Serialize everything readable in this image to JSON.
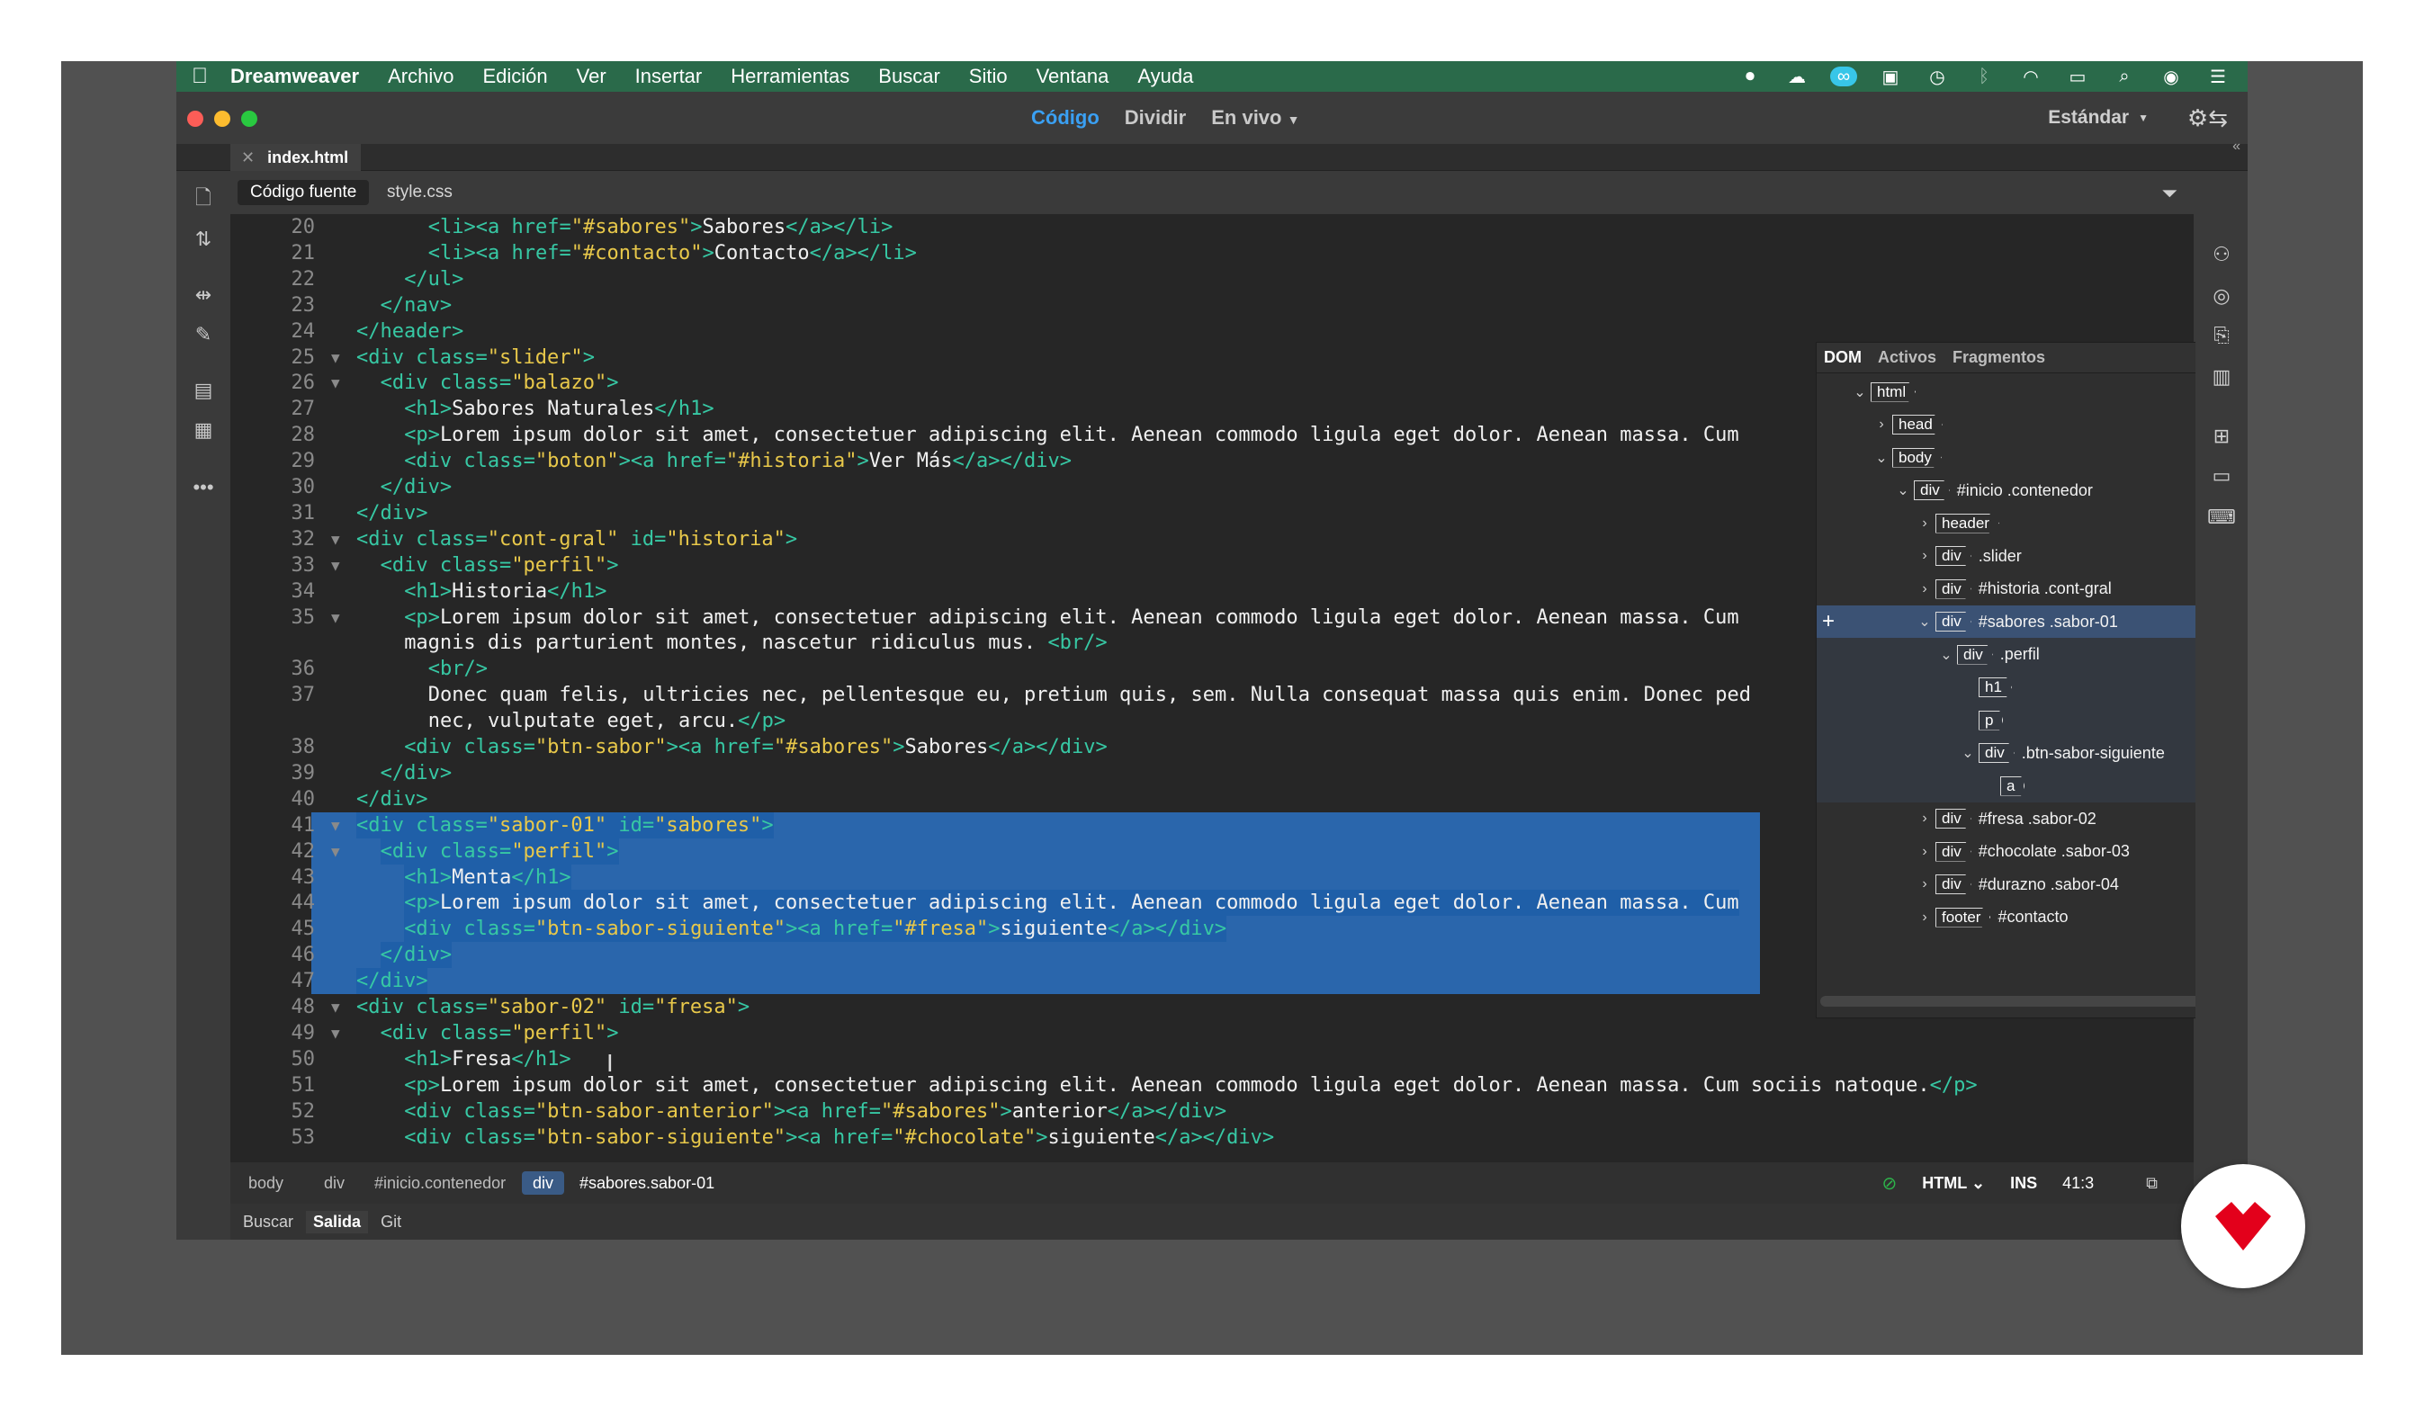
{
  "menubar": {
    "app": "Dreamweaver",
    "items": [
      "Archivo",
      "Edición",
      "Ver",
      "Insertar",
      "Herramientas",
      "Buscar",
      "Sitio",
      "Ventana",
      "Ayuda"
    ],
    "tray_icons": [
      "record-icon",
      "cloud-icon",
      "creative-cloud-icon",
      "chat-icon",
      "time-machine-icon",
      "bluetooth-icon",
      "wifi-icon",
      "battery-icon",
      "spotlight-icon",
      "siri-icon",
      "list-icon"
    ]
  },
  "titlebar": {
    "views": [
      "Código",
      "Dividir",
      "En vivo"
    ],
    "active_view": "Código",
    "workspace": "Estándar"
  },
  "document_tab": "index.html",
  "related_files": [
    "Código fuente",
    "style.css"
  ],
  "code_lines": [
    {
      "n": "20",
      "fold": "",
      "sel": false,
      "indent": 6,
      "parts": [
        [
          "tag",
          "<li><a "
        ],
        [
          "attr",
          "href="
        ],
        [
          "str",
          "\"#sabores\""
        ],
        [
          "tag",
          ">"
        ],
        [
          "txt",
          "Sabores"
        ],
        [
          "tag",
          "</a></li>"
        ]
      ]
    },
    {
      "n": "21",
      "fold": "",
      "sel": false,
      "indent": 6,
      "parts": [
        [
          "tag",
          "<li><a "
        ],
        [
          "attr",
          "href="
        ],
        [
          "str",
          "\"#contacto\""
        ],
        [
          "tag",
          ">"
        ],
        [
          "txt",
          "Contacto"
        ],
        [
          "tag",
          "</a></li>"
        ]
      ]
    },
    {
      "n": "22",
      "fold": "",
      "sel": false,
      "indent": 4,
      "parts": [
        [
          "tag",
          "</ul>"
        ]
      ]
    },
    {
      "n": "23",
      "fold": "",
      "sel": false,
      "indent": 2,
      "parts": [
        [
          "tag",
          "</nav>"
        ]
      ]
    },
    {
      "n": "24",
      "fold": "",
      "sel": false,
      "indent": 0,
      "parts": [
        [
          "tag",
          "</header>"
        ]
      ]
    },
    {
      "n": "25",
      "fold": "▼",
      "sel": false,
      "indent": 0,
      "parts": [
        [
          "tag",
          "<div "
        ],
        [
          "attr",
          "class="
        ],
        [
          "str",
          "\"slider\""
        ],
        [
          "tag",
          ">"
        ]
      ]
    },
    {
      "n": "26",
      "fold": "▼",
      "sel": false,
      "indent": 2,
      "parts": [
        [
          "tag",
          "<div "
        ],
        [
          "attr",
          "class="
        ],
        [
          "str",
          "\"balazo\""
        ],
        [
          "tag",
          ">"
        ]
      ]
    },
    {
      "n": "27",
      "fold": "",
      "sel": false,
      "indent": 4,
      "parts": [
        [
          "tag",
          "<h1>"
        ],
        [
          "txt",
          "Sabores Naturales"
        ],
        [
          "tag",
          "</h1>"
        ]
      ]
    },
    {
      "n": "28",
      "fold": "",
      "sel": false,
      "indent": 4,
      "parts": [
        [
          "tag",
          "<p>"
        ],
        [
          "txt",
          "Lorem ipsum dolor sit amet, consectetuer adipiscing elit. Aenean commodo ligula eget dolor. Aenean massa. Cum"
        ]
      ]
    },
    {
      "n": "29",
      "fold": "",
      "sel": false,
      "indent": 4,
      "parts": [
        [
          "tag",
          "<div "
        ],
        [
          "attr",
          "class="
        ],
        [
          "str",
          "\"boton\""
        ],
        [
          "tag",
          "><a "
        ],
        [
          "attr",
          "href="
        ],
        [
          "str",
          "\"#historia\""
        ],
        [
          "tag",
          ">"
        ],
        [
          "txt",
          "Ver Más"
        ],
        [
          "tag",
          "</a></div>"
        ]
      ]
    },
    {
      "n": "30",
      "fold": "",
      "sel": false,
      "indent": 2,
      "parts": [
        [
          "tag",
          "</div>"
        ]
      ]
    },
    {
      "n": "31",
      "fold": "",
      "sel": false,
      "indent": 0,
      "parts": [
        [
          "tag",
          "</div>"
        ]
      ]
    },
    {
      "n": "32",
      "fold": "▼",
      "sel": false,
      "indent": 0,
      "parts": [
        [
          "tag",
          "<div "
        ],
        [
          "attr",
          "class="
        ],
        [
          "str",
          "\"cont-gral\""
        ],
        [
          "txt",
          " "
        ],
        [
          "attr",
          "id="
        ],
        [
          "str",
          "\"historia\""
        ],
        [
          "tag",
          ">"
        ]
      ]
    },
    {
      "n": "33",
      "fold": "▼",
      "sel": false,
      "indent": 2,
      "parts": [
        [
          "tag",
          "<div "
        ],
        [
          "attr",
          "class="
        ],
        [
          "str",
          "\"perfil\""
        ],
        [
          "tag",
          ">"
        ]
      ]
    },
    {
      "n": "34",
      "fold": "",
      "sel": false,
      "indent": 4,
      "parts": [
        [
          "tag",
          "<h1>"
        ],
        [
          "txt",
          "Historia"
        ],
        [
          "tag",
          "</h1>"
        ]
      ]
    },
    {
      "n": "35",
      "fold": "▼",
      "sel": false,
      "indent": 4,
      "parts": [
        [
          "tag",
          "<p>"
        ],
        [
          "txt",
          "Lorem ipsum dolor sit amet, consectetuer adipiscing elit. Aenean commodo ligula eget dolor. Aenean massa. Cum"
        ]
      ]
    },
    {
      "n": "",
      "fold": "",
      "sel": false,
      "indent": 4,
      "parts": [
        [
          "txt",
          "magnis dis parturient montes, nascetur ridiculus mus. "
        ],
        [
          "tag",
          "<br/>"
        ]
      ]
    },
    {
      "n": "36",
      "fold": "",
      "sel": false,
      "indent": 6,
      "parts": [
        [
          "tag",
          "<br/>"
        ]
      ]
    },
    {
      "n": "37",
      "fold": "",
      "sel": false,
      "indent": 6,
      "parts": [
        [
          "txt",
          "Donec quam felis, ultricies nec, pellentesque eu, pretium quis, sem. Nulla consequat massa quis enim. Donec ped"
        ]
      ]
    },
    {
      "n": "",
      "fold": "",
      "sel": false,
      "indent": 6,
      "parts": [
        [
          "txt",
          "nec, vulputate eget, arcu."
        ],
        [
          "tag",
          "</p>"
        ]
      ]
    },
    {
      "n": "38",
      "fold": "",
      "sel": false,
      "indent": 4,
      "parts": [
        [
          "tag",
          "<div "
        ],
        [
          "attr",
          "class="
        ],
        [
          "str",
          "\"btn-sabor\""
        ],
        [
          "tag",
          "><a "
        ],
        [
          "attr",
          "href="
        ],
        [
          "str",
          "\"#sabores\""
        ],
        [
          "tag",
          ">"
        ],
        [
          "txt",
          "Sabores"
        ],
        [
          "tag",
          "</a></div>"
        ]
      ]
    },
    {
      "n": "39",
      "fold": "",
      "sel": false,
      "indent": 2,
      "parts": [
        [
          "tag",
          "</div>"
        ]
      ]
    },
    {
      "n": "40",
      "fold": "",
      "sel": false,
      "indent": 0,
      "parts": [
        [
          "tag",
          "</div>"
        ]
      ]
    },
    {
      "n": "41",
      "fold": "▼",
      "sel": true,
      "indent": 0,
      "parts": [
        [
          "tag",
          "<div "
        ],
        [
          "attr",
          "class="
        ],
        [
          "str",
          "\"sabor-01\""
        ],
        [
          "txt",
          " "
        ],
        [
          "attr",
          "id="
        ],
        [
          "str",
          "\"sabores\""
        ],
        [
          "tag",
          ">"
        ]
      ]
    },
    {
      "n": "42",
      "fold": "▼",
      "sel": true,
      "indent": 2,
      "parts": [
        [
          "tag",
          "<div "
        ],
        [
          "attr",
          "class="
        ],
        [
          "str",
          "\"perfil\""
        ],
        [
          "tag",
          ">"
        ]
      ]
    },
    {
      "n": "43",
      "fold": "",
      "sel": true,
      "indent": 4,
      "parts": [
        [
          "tag",
          "<h1>"
        ],
        [
          "txt",
          "Menta"
        ],
        [
          "tag",
          "</h1>"
        ]
      ]
    },
    {
      "n": "44",
      "fold": "",
      "sel": true,
      "indent": 4,
      "parts": [
        [
          "tag",
          "<p>"
        ],
        [
          "txt",
          "Lorem ipsum dolor sit amet, consectetuer adipiscing elit. Aenean commodo ligula eget dolor. Aenean massa. Cum"
        ]
      ]
    },
    {
      "n": "45",
      "fold": "",
      "sel": true,
      "indent": 4,
      "parts": [
        [
          "tag",
          "<div "
        ],
        [
          "attr",
          "class="
        ],
        [
          "str",
          "\"btn-sabor-siguiente\""
        ],
        [
          "tag",
          "><a "
        ],
        [
          "attr",
          "href="
        ],
        [
          "str",
          "\"#fresa\""
        ],
        [
          "tag",
          ">"
        ],
        [
          "txt",
          "siguiente"
        ],
        [
          "tag",
          "</a></div>"
        ]
      ]
    },
    {
      "n": "46",
      "fold": "",
      "sel": true,
      "indent": 2,
      "parts": [
        [
          "tag",
          "</div>"
        ]
      ]
    },
    {
      "n": "47",
      "fold": "",
      "sel": true,
      "indent": 0,
      "parts": [
        [
          "tag",
          "</div>"
        ]
      ]
    },
    {
      "n": "48",
      "fold": "▼",
      "sel": false,
      "indent": 0,
      "parts": [
        [
          "tag",
          "<div "
        ],
        [
          "attr",
          "class="
        ],
        [
          "str",
          "\"sabor-02\""
        ],
        [
          "txt",
          " "
        ],
        [
          "attr",
          "id="
        ],
        [
          "str",
          "\"fresa\""
        ],
        [
          "tag",
          ">"
        ]
      ]
    },
    {
      "n": "49",
      "fold": "▼",
      "sel": false,
      "indent": 2,
      "parts": [
        [
          "tag",
          "<div "
        ],
        [
          "attr",
          "class="
        ],
        [
          "str",
          "\"perfil\""
        ],
        [
          "tag",
          ">"
        ]
      ]
    },
    {
      "n": "50",
      "fold": "",
      "sel": false,
      "indent": 4,
      "parts": [
        [
          "tag",
          "<h1>"
        ],
        [
          "txt",
          "Fresa"
        ],
        [
          "tag",
          "</h1>"
        ]
      ]
    },
    {
      "n": "51",
      "fold": "",
      "sel": false,
      "indent": 4,
      "parts": [
        [
          "tag",
          "<p>"
        ],
        [
          "txt",
          "Lorem ipsum dolor sit amet, consectetuer adipiscing elit. Aenean commodo ligula eget dolor. Aenean massa. Cum sociis natoque."
        ],
        [
          "tag",
          "</p>"
        ]
      ]
    },
    {
      "n": "52",
      "fold": "",
      "sel": false,
      "indent": 4,
      "parts": [
        [
          "tag",
          "<div "
        ],
        [
          "attr",
          "class="
        ],
        [
          "str",
          "\"btn-sabor-anterior\""
        ],
        [
          "tag",
          "><a "
        ],
        [
          "attr",
          "href="
        ],
        [
          "str",
          "\"#sabores\""
        ],
        [
          "tag",
          ">"
        ],
        [
          "txt",
          "anterior"
        ],
        [
          "tag",
          "</a></div>"
        ]
      ]
    },
    {
      "n": "53",
      "fold": "",
      "sel": false,
      "indent": 4,
      "parts": [
        [
          "tag",
          "<div "
        ],
        [
          "attr",
          "class="
        ],
        [
          "str",
          "\"btn-sabor-siguiente\""
        ],
        [
          "tag",
          "><a "
        ],
        [
          "attr",
          "href="
        ],
        [
          "str",
          "\"#chocolate\""
        ],
        [
          "tag",
          ">"
        ],
        [
          "txt",
          "siguiente"
        ],
        [
          "tag",
          "</a></div>"
        ]
      ]
    }
  ],
  "dom_panel": {
    "tabs": [
      "DOM",
      "Activos",
      "Fragmentos"
    ],
    "active_tab": "DOM",
    "nodes": [
      {
        "depth": 1,
        "chev": "⌄",
        "tag": "html",
        "label": "",
        "state": ""
      },
      {
        "depth": 2,
        "chev": "›",
        "tag": "head",
        "label": "",
        "state": ""
      },
      {
        "depth": 2,
        "chev": "⌄",
        "tag": "body",
        "label": "",
        "state": ""
      },
      {
        "depth": 3,
        "chev": "⌄",
        "tag": "div",
        "label": "#inicio .contenedor",
        "state": ""
      },
      {
        "depth": 4,
        "chev": "›",
        "tag": "header",
        "label": "",
        "state": ""
      },
      {
        "depth": 4,
        "chev": "›",
        "tag": "div",
        "label": ".slider",
        "state": ""
      },
      {
        "depth": 4,
        "chev": "›",
        "tag": "div",
        "label": "#historia .cont-gral",
        "state": ""
      },
      {
        "depth": 4,
        "chev": "⌄",
        "tag": "div",
        "label": "#sabores .sabor-01",
        "state": "selected"
      },
      {
        "depth": 5,
        "chev": "⌄",
        "tag": "div",
        "label": ".perfil",
        "state": "sub"
      },
      {
        "depth": 6,
        "chev": "",
        "tag": "h1",
        "label": "",
        "state": "sub"
      },
      {
        "depth": 6,
        "chev": "",
        "tag": "p",
        "label": "",
        "state": "sub"
      },
      {
        "depth": 6,
        "chev": "⌄",
        "tag": "div",
        "label": ".btn-sabor-siguiente",
        "state": "sub"
      },
      {
        "depth": 7,
        "chev": "",
        "tag": "a",
        "label": "",
        "state": "sub"
      },
      {
        "depth": 4,
        "chev": "›",
        "tag": "div",
        "label": "#fresa .sabor-02",
        "state": ""
      },
      {
        "depth": 4,
        "chev": "›",
        "tag": "div",
        "label": "#chocolate .sabor-03",
        "state": ""
      },
      {
        "depth": 4,
        "chev": "›",
        "tag": "div",
        "label": "#durazno .sabor-04",
        "state": ""
      },
      {
        "depth": 4,
        "chev": "›",
        "tag": "footer",
        "label": "#contacto",
        "state": ""
      }
    ]
  },
  "statusbar": {
    "crumbs": [
      "body",
      "div",
      "#inicio.contenedor",
      "div",
      "#sabores.sabor-01"
    ],
    "active_crumb_index": 3,
    "language": "HTML",
    "mode": "INS",
    "position": "41:3"
  },
  "bottom_tabs": [
    "Buscar",
    "Salida",
    "Git"
  ],
  "active_bottom_tab": "Salida",
  "colors": {
    "menubar": "#2a6a4a",
    "selection": "#2a66ac",
    "tag": "#37c8a4",
    "string": "#e8c84a",
    "brand": "#e3001b"
  }
}
